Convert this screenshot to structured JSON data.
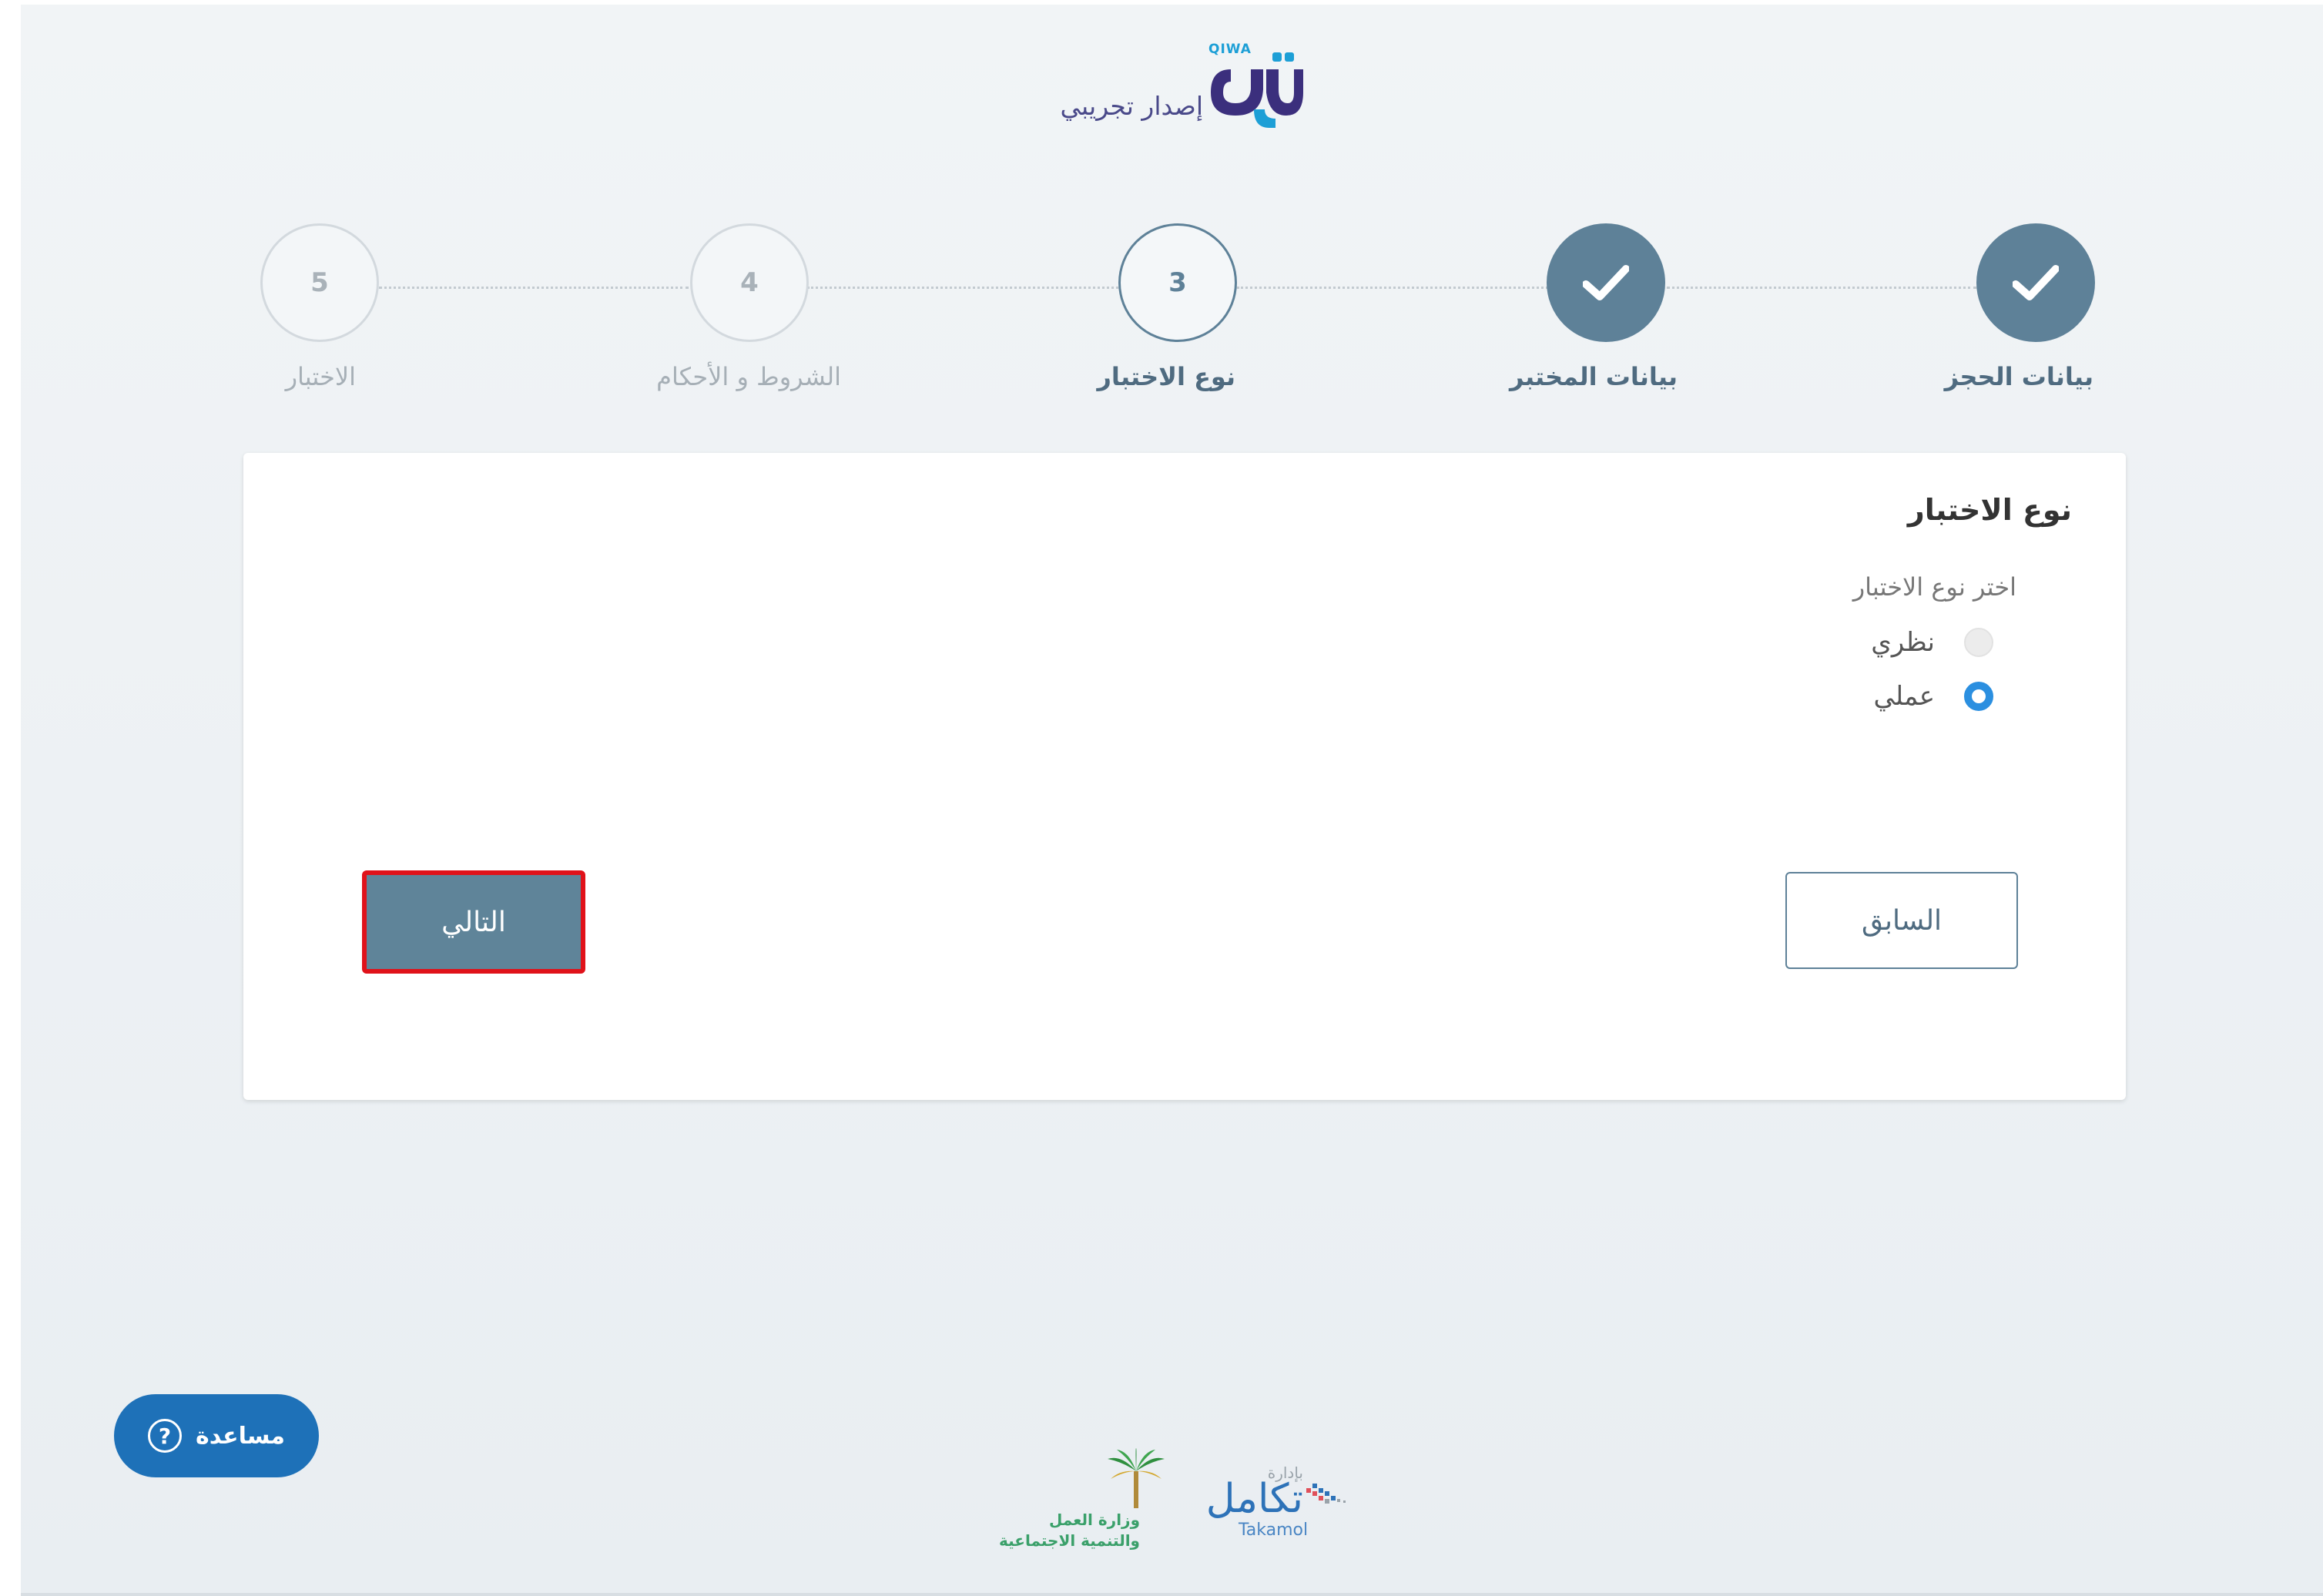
{
  "header": {
    "logo_latin": "QIWA",
    "logo_arabic": "قوى",
    "subtitle": "إصدار تجريبي"
  },
  "stepper": {
    "steps": [
      {
        "number": "1",
        "label": "بيانات الحجز",
        "state": "done"
      },
      {
        "number": "2",
        "label": "بيانات المختبر",
        "state": "done"
      },
      {
        "number": "3",
        "label": "نوع الاختبار",
        "state": "active"
      },
      {
        "number": "4",
        "label": "الشروط و الأحكام",
        "state": "pending"
      },
      {
        "number": "5",
        "label": "الاختبار",
        "state": "pending"
      }
    ]
  },
  "form": {
    "title": "نوع الاختبار",
    "field_label": "اختر نوع الاختبار",
    "options": [
      {
        "label": "نظري",
        "selected": false
      },
      {
        "label": "عملي",
        "selected": true
      }
    ],
    "prev_label": "السابق",
    "next_label": "التالي"
  },
  "help": {
    "label": "مساعدة",
    "icon": "question-circle-icon"
  },
  "footer": {
    "takamol_small": "بإدارة",
    "takamol_arabic": "تكامل",
    "takamol_latin": "Takamol",
    "ministry_line1": "وزارة العمل",
    "ministry_line2": "والتنمية الاجتماعية"
  },
  "colors": {
    "step_done": "#5e8198",
    "accent_blue": "#2b8fe0",
    "help_bg": "#1e71b8",
    "highlight": "#e0121a"
  }
}
